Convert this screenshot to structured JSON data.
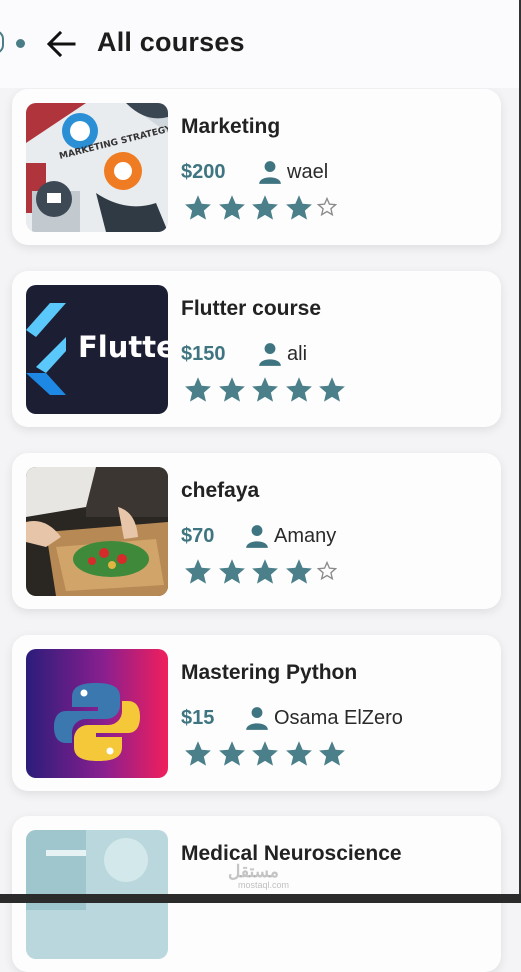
{
  "header": {
    "title": "All courses"
  },
  "courses": [
    {
      "name": "Marketing",
      "price": "$200",
      "author": "wael",
      "rating": 4,
      "thumb_label": "MARKETING STRATEGY"
    },
    {
      "name": "Flutter course",
      "price": "$150",
      "author": "ali",
      "rating": 5,
      "thumb_label": "Flutter"
    },
    {
      "name": "chefaya",
      "price": "$70",
      "author": "Amany",
      "rating": 4
    },
    {
      "name": "Mastering Python",
      "price": "$15",
      "author": "Osama ElZero",
      "rating": 5
    },
    {
      "name": "Medical Neuroscience"
    }
  ],
  "watermark": {
    "text": "مستقل",
    "sub": "mostaql.com"
  },
  "colors": {
    "accent": "#3f7580",
    "star": "#4b7f89",
    "card": "#fdfdfd",
    "background": "#f4f4f6"
  }
}
